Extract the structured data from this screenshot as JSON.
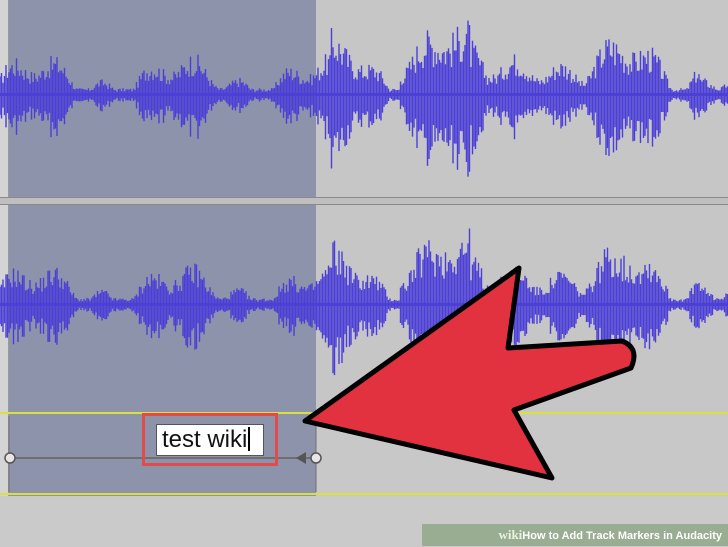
{
  "label_track": {
    "label_text": "test wiki"
  },
  "watermark": {
    "brand": "wiki",
    "how": "How",
    "title": " to Add Track Markers in Audacity"
  },
  "colors": {
    "waveform": "#4b3fd6",
    "selection": "#8e93ac",
    "background": "#c6c6c6",
    "arrow": "#e2323f",
    "highlight": "#e34a4a",
    "label_track_line": "#d8e23a"
  },
  "icons": {
    "arrow": "pointer-arrow-icon",
    "label_handle_left": "label-handle-left-icon",
    "label_handle_right": "label-handle-right-icon"
  }
}
